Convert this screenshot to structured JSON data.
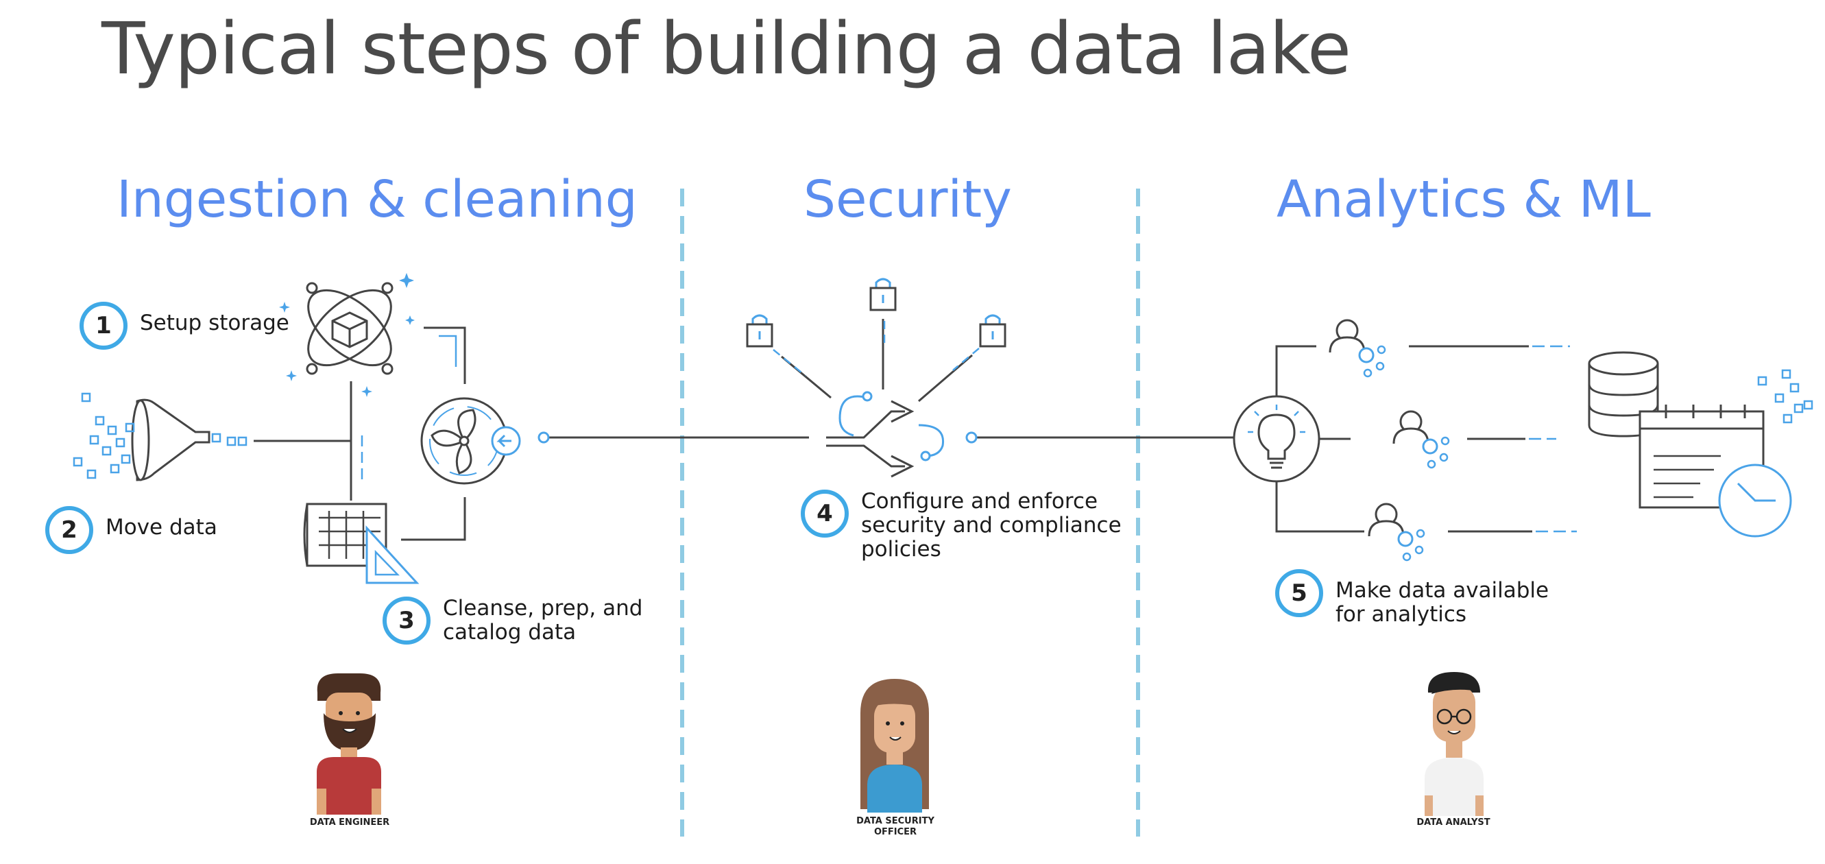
{
  "title": "Typical steps of building a data lake",
  "sections": {
    "ingestion": "Ingestion & cleaning",
    "security": "Security",
    "analytics": "Analytics & ML"
  },
  "steps": [
    {
      "num": "1",
      "text": "Setup storage"
    },
    {
      "num": "2",
      "text": "Move data"
    },
    {
      "num": "3",
      "text": "Cleanse, prep, and\ncatalog data"
    },
    {
      "num": "4",
      "text": "Configure and enforce\nsecurity and compliance\npolicies"
    },
    {
      "num": "5",
      "text": "Make data available\nfor analytics"
    }
  ],
  "roles": {
    "engineer": "DATA ENGINEER",
    "security_officer": "DATA SECURITY\nOFFICER",
    "analyst": "DATA ANALYST"
  },
  "colors": {
    "accent_blue": "#5b8def",
    "step_ring": "#3fa9e6",
    "icon_blue": "#4aa3e8",
    "line_gray": "#444444",
    "divider": "#8fcbe3"
  }
}
